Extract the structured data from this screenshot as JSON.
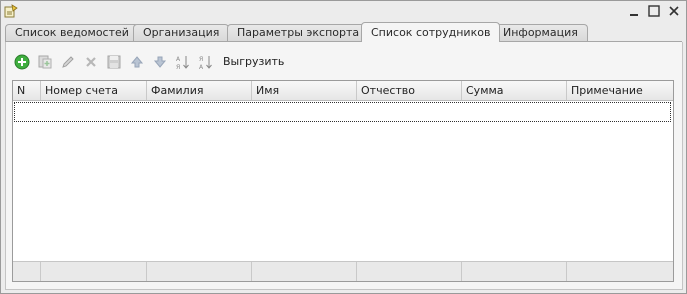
{
  "tabs": [
    {
      "label": "Список ведомостей",
      "active": false
    },
    {
      "label": "Организация",
      "active": false
    },
    {
      "label": "Параметры экспорта",
      "active": false
    },
    {
      "label": "Список сотрудников",
      "active": true
    },
    {
      "label": "Информация",
      "active": false
    }
  ],
  "toolbar": {
    "buttons": [
      "add-icon",
      "copy-icon",
      "edit-icon",
      "delete-icon",
      "save-icon",
      "move-up-icon",
      "move-down-icon",
      "sort-ascending-icon",
      "sort-descending-icon"
    ],
    "export_label": "Выгрузить"
  },
  "table": {
    "columns": [
      "N",
      "Номер счета",
      "Фамилия",
      "Имя",
      "Отчество",
      "Сумма",
      "Примечание"
    ],
    "rows": []
  },
  "colors": {
    "accent_green": "#3fae3f",
    "arrow_blue": "#5a83b8"
  }
}
